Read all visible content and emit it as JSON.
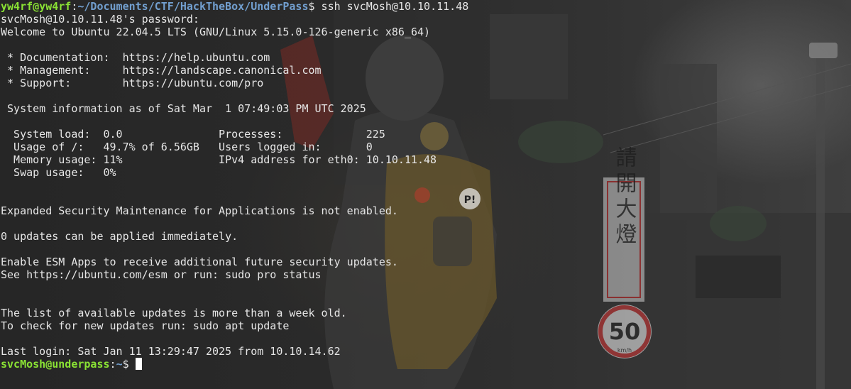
{
  "colors": {
    "prompt_user": "#8ae234",
    "prompt_path": "#729fcf",
    "text": "#e6e6e6",
    "cursor": "#ffffff"
  },
  "prompt1": {
    "user_host": "yw4rf@yw4rf",
    "sep": ":",
    "path": "~/Documents/CTF/HackTheBox/UnderPass",
    "symbol": "$ ",
    "command": "ssh svcMosh@10.10.11.48"
  },
  "output_lines": [
    "svcMosh@10.10.11.48's password:",
    "Welcome to Ubuntu 22.04.5 LTS (GNU/Linux 5.15.0-126-generic x86_64)",
    "",
    " * Documentation:  https://help.ubuntu.com",
    " * Management:     https://landscape.canonical.com",
    " * Support:        https://ubuntu.com/pro",
    "",
    " System information as of Sat Mar  1 07:49:03 PM UTC 2025",
    "",
    "  System load:  0.0               Processes:             225",
    "  Usage of /:   49.7% of 6.56GB   Users logged in:       0",
    "  Memory usage: 11%               IPv4 address for eth0: 10.10.11.48",
    "  Swap usage:   0%",
    "",
    "",
    "Expanded Security Maintenance for Applications is not enabled.",
    "",
    "0 updates can be applied immediately.",
    "",
    "Enable ESM Apps to receive additional future security updates.",
    "See https://ubuntu.com/esm or run: sudo pro status",
    "",
    "",
    "The list of available updates is more than a week old.",
    "To check for new updates run: sudo apt update",
    "",
    "Last login: Sat Jan 11 13:29:47 2025 from 10.10.14.62"
  ],
  "prompt2": {
    "user_host": "svcMosh@underpass",
    "sep": ":",
    "path": "~",
    "symbol": "$ "
  },
  "wallpaper": {
    "sign_text": "請開大燈",
    "speed_limit": "50",
    "speed_unit": "km/h",
    "badge_text": "P!"
  }
}
